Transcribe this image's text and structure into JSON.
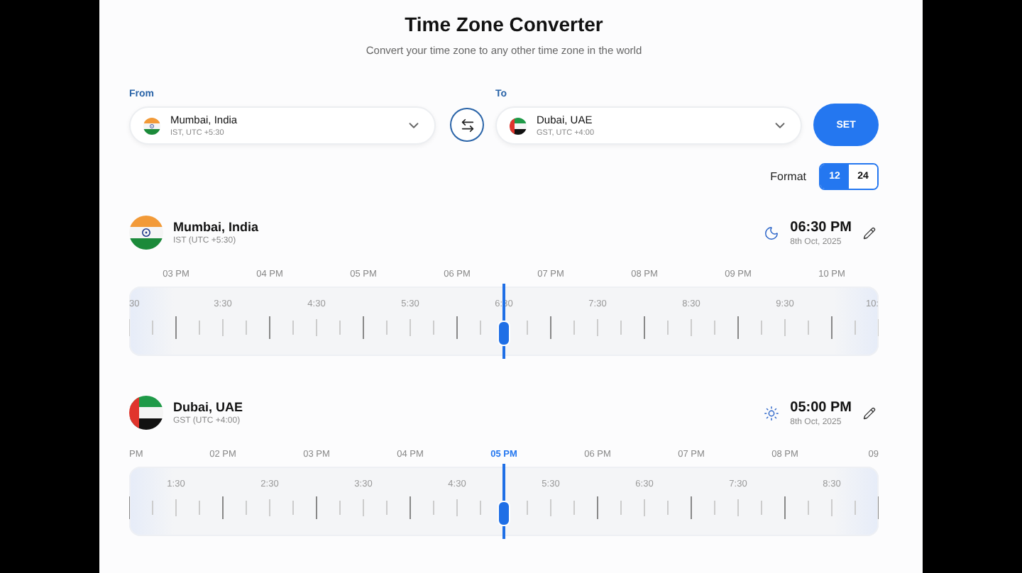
{
  "title": "Time Zone Converter",
  "subtitle": "Convert your time zone to any other time zone in the world",
  "from": {
    "label": "From",
    "city": "Mumbai, India",
    "zone": "IST, UTC +5:30"
  },
  "to": {
    "label": "To",
    "city": "Dubai, UAE",
    "zone": "GST, UTC +4:00"
  },
  "set_button": "SET",
  "format": {
    "label": "Format",
    "options": [
      {
        "label": "12",
        "selected": true
      },
      {
        "label": "24",
        "selected": false
      }
    ]
  },
  "timelines": [
    {
      "city": "Mumbai, India",
      "zone": "IST (UTC +5:30)",
      "time": "06:30 PM",
      "date": "8th Oct, 2025",
      "level": 0.5,
      "hours": [
        {
          "label": "03 PM",
          "selected": false
        },
        {
          "label": "04 PM",
          "selected": false
        },
        {
          "label": "05 PM",
          "selected": false
        },
        {
          "label": "06 PM",
          "selected": false
        },
        {
          "label": "07 PM",
          "selected": false
        },
        {
          "label": "08 PM",
          "selected": false
        },
        {
          "label": "09 PM",
          "selected": false
        },
        {
          "label": "10 PM",
          "selected": false
        }
      ],
      "halves": [
        "30",
        "3:30",
        "4:30",
        "5:30",
        "6:30",
        "7:30",
        "8:30",
        "9:30",
        "10:"
      ]
    },
    {
      "city": "Dubai, UAE",
      "zone": "GST (UTC +4:00)",
      "time": "05:00 PM",
      "date": "8th Oct, 2025",
      "level": 0.5,
      "hours": [
        {
          "label": "PM",
          "selected": false
        },
        {
          "label": "02 PM",
          "selected": false
        },
        {
          "label": "03 PM",
          "selected": false
        },
        {
          "label": "04 PM",
          "selected": false
        },
        {
          "label": "05 PM",
          "selected": true
        },
        {
          "label": "06 PM",
          "selected": false
        },
        {
          "label": "07 PM",
          "selected": false
        },
        {
          "label": "08 PM",
          "selected": false
        },
        {
          "label": "09",
          "selected": false
        }
      ],
      "halves": [
        "1:30",
        "2:30",
        "3:30",
        "4:30",
        "5:30",
        "6:30",
        "7:30",
        "8:30"
      ]
    }
  ]
}
